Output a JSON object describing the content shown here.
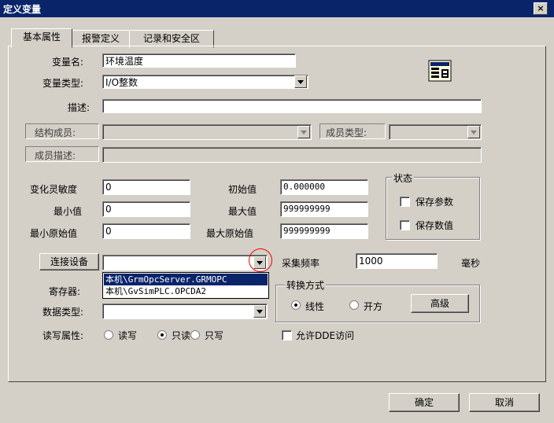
{
  "window": {
    "title": "定义变量",
    "close": "×"
  },
  "tabs": [
    {
      "label": "基本属性"
    },
    {
      "label": "报警定义"
    },
    {
      "label": "记录和安全区"
    }
  ],
  "fields": {
    "var_name_label": "变量名:",
    "var_name_value": "环境温度",
    "var_type_label": "变量类型:",
    "var_type_value": "I/O整数",
    "desc_label": "描述:",
    "desc_value": "",
    "struct_member_label": "结构成员:",
    "member_type_label": "成员类型:",
    "member_desc_label": "成员描述:",
    "sensitivity_label": "变化灵敏度",
    "sensitivity_value": "0",
    "init_label": "初始值",
    "init_value": "0.000000",
    "min_label": "最小值",
    "min_value": "0",
    "max_label": "最大值",
    "max_value": "999999999",
    "min_raw_label": "最小原始值",
    "min_raw_value": "0",
    "max_raw_label": "最大原始值",
    "max_raw_value": "999999999",
    "connect_button": "连接设备",
    "sample_label": "采集频率",
    "sample_value": "1000",
    "ms_label": "毫秒",
    "register_label": "寄存器:",
    "datatype_label": "数据类型:",
    "rw_label": "读写属性:",
    "rw_options": [
      "读写",
      "只读",
      "只写"
    ],
    "dde_label": "允许DDE访问"
  },
  "state_group": {
    "title": "状态",
    "save_param": "保存参数",
    "save_value": "保存数值"
  },
  "convert_group": {
    "title": "转换方式",
    "linear": "线性",
    "sqrt": "开方",
    "advanced": "高级"
  },
  "device_dropdown": {
    "items": [
      "本机\\GrmOpcServer.GRMOPC",
      "本机\\GvSimPLC.OPCDA2"
    ]
  },
  "footer": {
    "ok": "确定",
    "cancel": "取消"
  }
}
